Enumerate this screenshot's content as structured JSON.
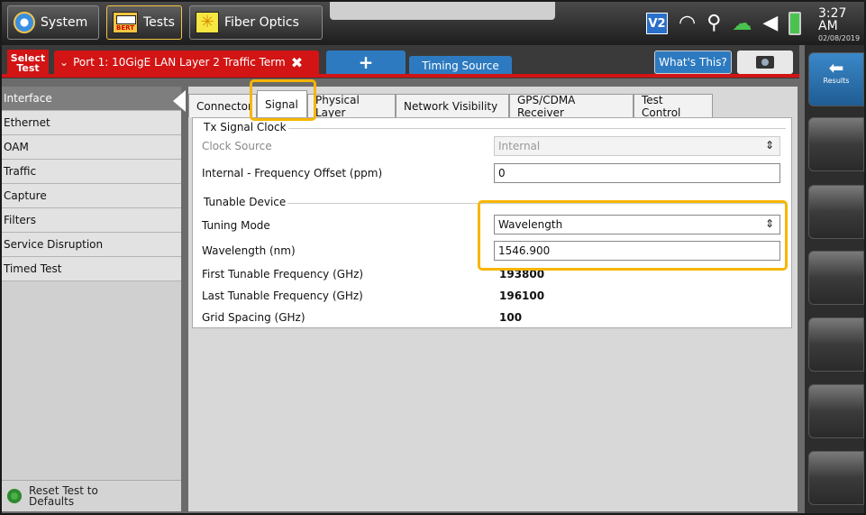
{
  "topbar": {
    "system_label": "System",
    "tests_label": "Tests",
    "bert_badge": "BERT",
    "fiber_label": "Fiber Optics",
    "time": "3:27 AM",
    "date": "02/08/2019",
    "v2_badge": "V2"
  },
  "testbar": {
    "select_test_line1": "Select",
    "select_test_line2": "Test",
    "port_tab_label": "Port 1: 10GigE LAN Layer 2 Traffic Term",
    "add_tab_label": "+",
    "timing_tab_label": "Timing Source",
    "whats_this_label": "What's This?"
  },
  "sidebar": {
    "items": [
      {
        "label": "Interface"
      },
      {
        "label": "Ethernet"
      },
      {
        "label": "OAM"
      },
      {
        "label": "Traffic"
      },
      {
        "label": "Capture"
      },
      {
        "label": "Filters"
      },
      {
        "label": "Service Disruption"
      },
      {
        "label": "Timed Test"
      }
    ],
    "reset_line1": "Reset Test to",
    "reset_line2": "Defaults"
  },
  "tabs": [
    {
      "label": "Connector"
    },
    {
      "label": "Signal"
    },
    {
      "label": "Physical Layer"
    },
    {
      "label": "Network Visibility"
    },
    {
      "label": "GPS/CDMA Receiver"
    },
    {
      "label": "Test Control"
    }
  ],
  "tx_signal_clock": {
    "title": "Tx Signal Clock",
    "clock_source_label": "Clock Source",
    "clock_source_value": "Internal",
    "freq_offset_label": "Internal - Frequency Offset (ppm)",
    "freq_offset_value": "0"
  },
  "tunable_device": {
    "title": "Tunable Device",
    "tuning_mode_label": "Tuning Mode",
    "tuning_mode_value": "Wavelength",
    "wavelength_label": "Wavelength (nm)",
    "wavelength_value": "1546.900",
    "first_freq_label": "First Tunable Frequency (GHz)",
    "first_freq_value": "193800",
    "last_freq_label": "Last Tunable Frequency (GHz)",
    "last_freq_value": "196100",
    "grid_spacing_label": "Grid Spacing (GHz)",
    "grid_spacing_value": "100"
  },
  "rail": {
    "results_label": "Results"
  },
  "colors": {
    "accent_red": "#d31414",
    "accent_blue": "#2d7ac0",
    "highlight": "#f7b500"
  }
}
